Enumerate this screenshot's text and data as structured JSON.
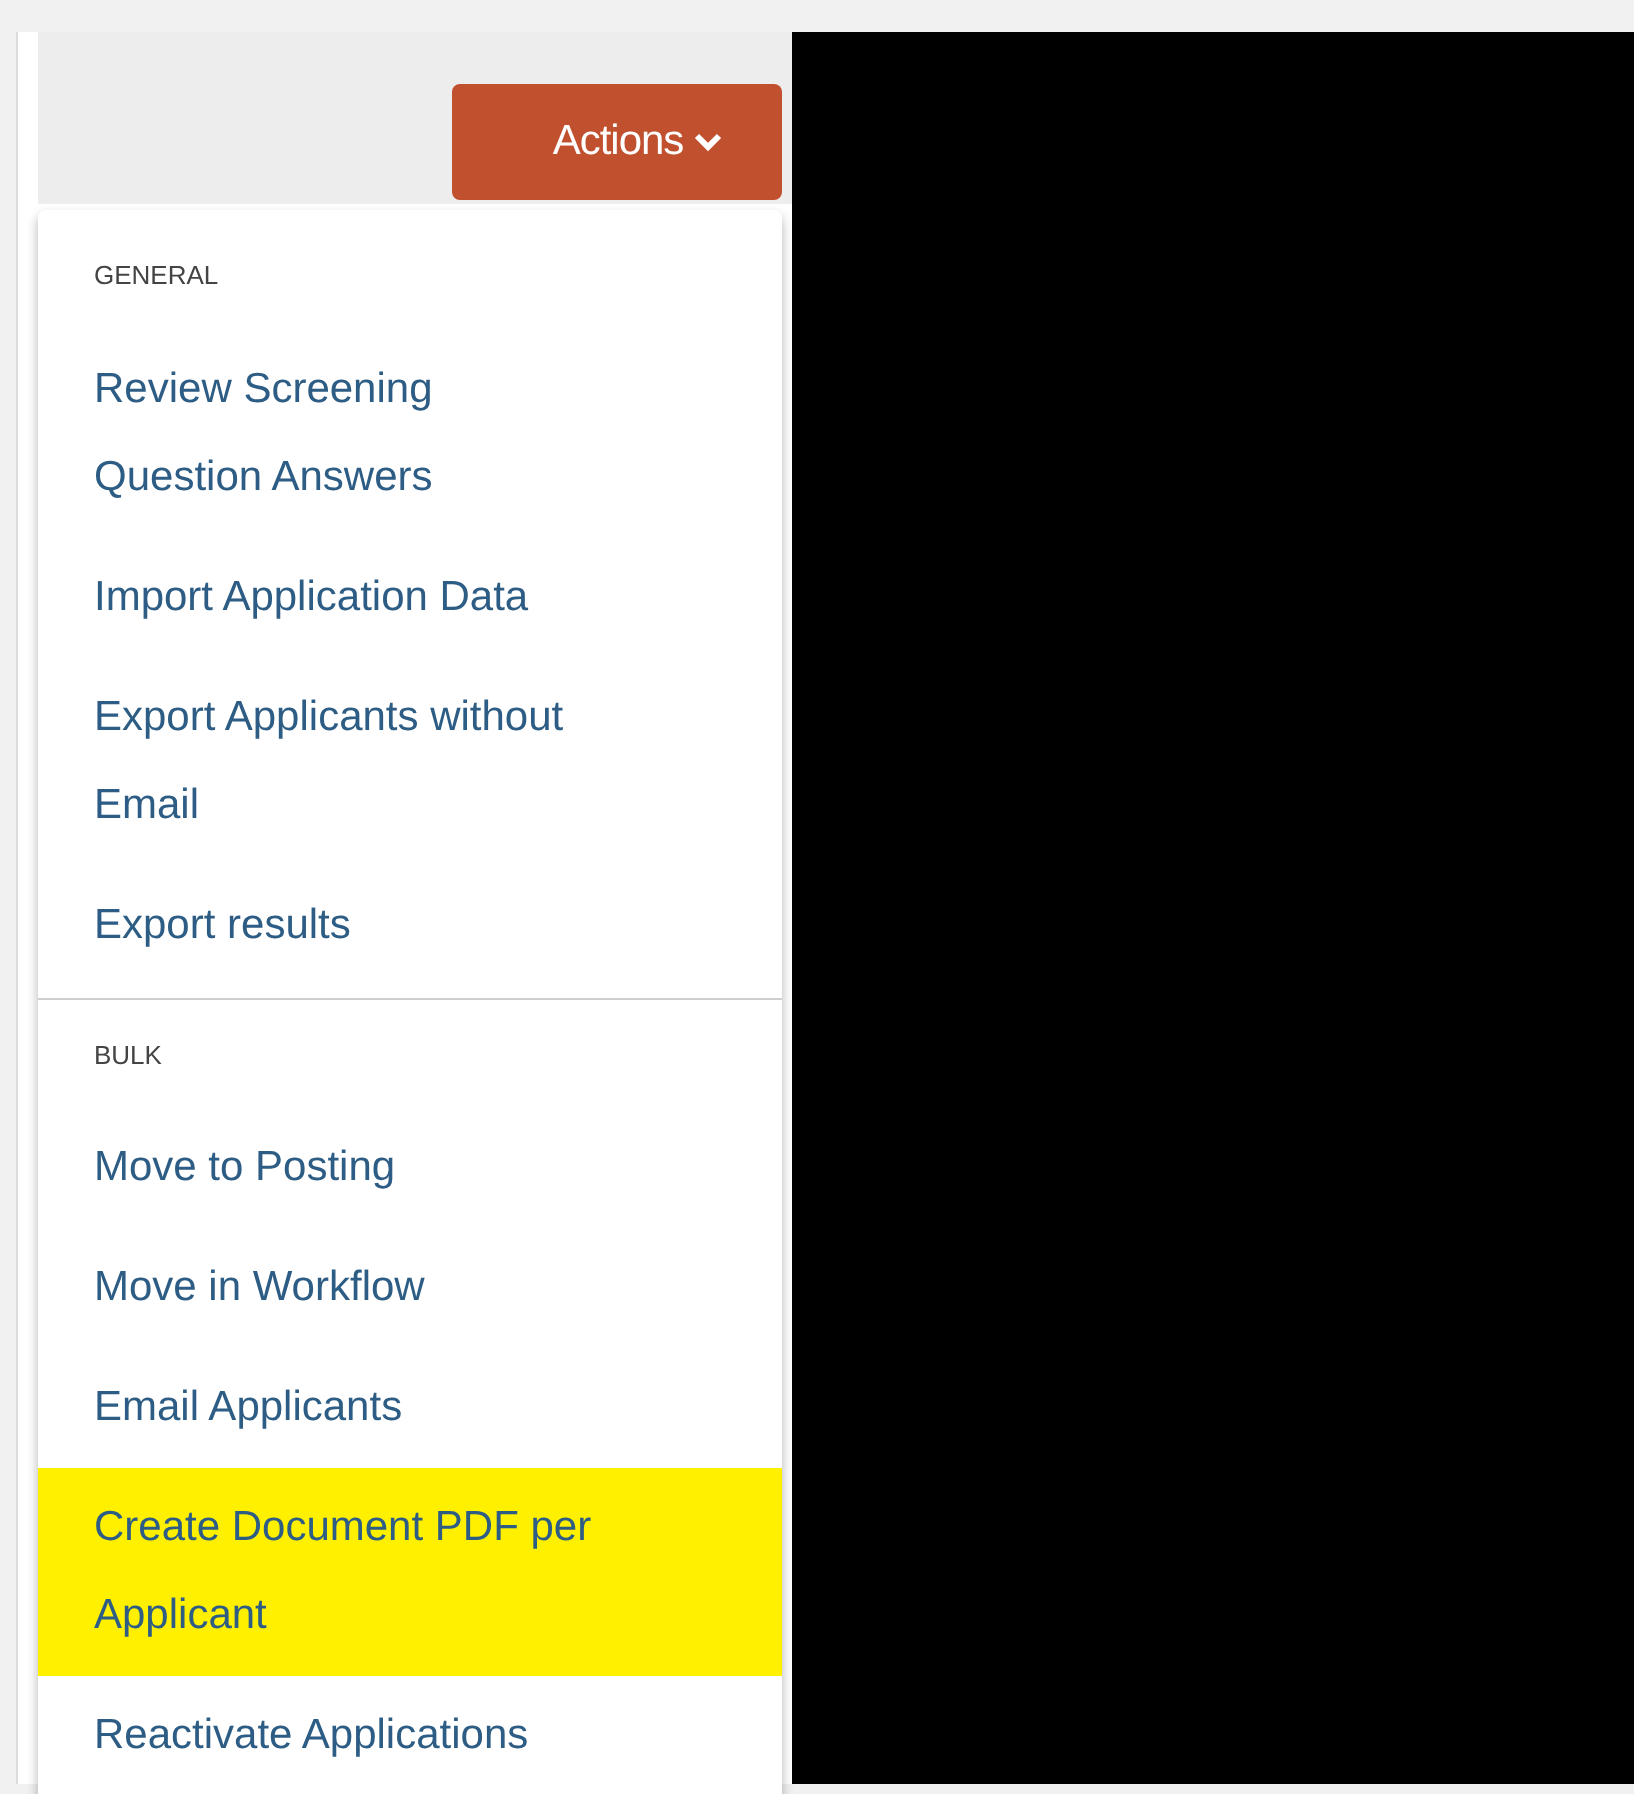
{
  "actions_button": {
    "label": "Actions"
  },
  "menu": {
    "sections": [
      {
        "heading": "GENERAL",
        "items": [
          {
            "label": "Review Screening Question Answers",
            "highlighted": false
          },
          {
            "label": "Import Application Data",
            "highlighted": false
          },
          {
            "label": "Export Applicants without Email",
            "highlighted": false
          },
          {
            "label": "Export results",
            "highlighted": false
          }
        ]
      },
      {
        "heading": "BULK",
        "items": [
          {
            "label": "Move to Posting",
            "highlighted": false
          },
          {
            "label": "Move in Workflow",
            "highlighted": false
          },
          {
            "label": "Email Applicants",
            "highlighted": false
          },
          {
            "label": "Create Document PDF per Applicant",
            "highlighted": true
          },
          {
            "label": "Reactivate Applications",
            "highlighted": false
          }
        ]
      }
    ]
  }
}
